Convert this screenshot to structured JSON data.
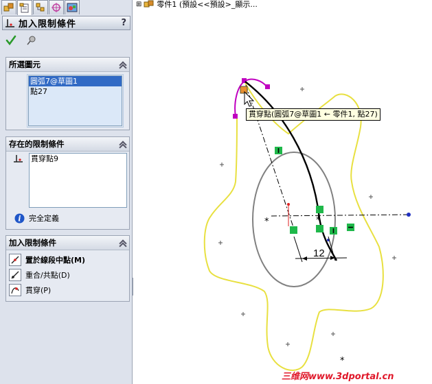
{
  "tree_node": "零件1  (預設<<預設>_顯示...",
  "property_manager": {
    "title": "加入限制條件",
    "help": "?",
    "selected_entities": {
      "header": "所選圖元",
      "items": [
        "圓弧7@草圖1",
        "點27"
      ]
    },
    "existing_relations": {
      "header": "存在的限制條件",
      "items": [
        "貫穿點9"
      ],
      "status": "完全定義"
    },
    "add_relations": {
      "header": "加入限制條件",
      "items": [
        "置於線段中點(M)",
        "重合/共點(D)",
        "貫穿(P)"
      ]
    }
  },
  "tooltip": "貫穿點(圓弧7@草圖1 ← 零件1, 點27)",
  "dimension": "12",
  "watermark": "三维网www.3dportal.cn",
  "colors": {
    "spline": "#e8e040",
    "relation_box": "#1fb84a",
    "selected_arc": "#c000c0",
    "construction": "#000000",
    "ellipse": "#808080",
    "watermark": "#e0182a"
  }
}
